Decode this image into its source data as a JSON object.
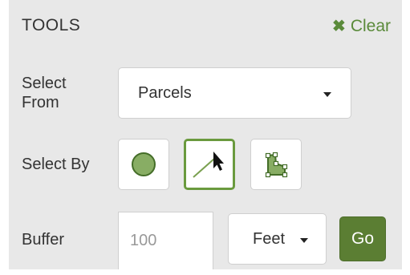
{
  "panel": {
    "title": "TOOLS",
    "clear_label": "Clear",
    "clear_icon": "close-icon",
    "accent_color": "#6a9a3e"
  },
  "select_from": {
    "label": "Select\nFrom",
    "label_line1": "Select",
    "label_line2": "From",
    "value": "Parcels"
  },
  "select_by": {
    "label": "Select By",
    "tools": [
      {
        "icon": "circle-tool-icon",
        "selected": false
      },
      {
        "icon": "line-select-tool-icon",
        "selected": true
      },
      {
        "icon": "polygon-tool-icon",
        "selected": false
      }
    ]
  },
  "buffer": {
    "label": "Buffer",
    "placeholder": "100",
    "units": "Feet",
    "go_label": "Go"
  }
}
